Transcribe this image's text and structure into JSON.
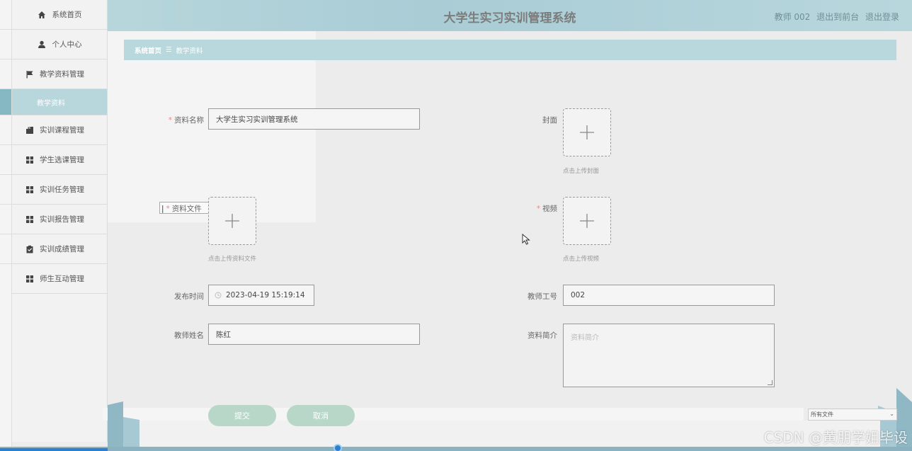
{
  "header": {
    "title": "大学生实习实训管理系统",
    "user_label": "教师 002",
    "back_link": "退出到前台",
    "logout_link": "退出登录"
  },
  "sidebar": {
    "items": [
      {
        "label": "系统首页",
        "icon": "home-icon"
      },
      {
        "label": "个人中心",
        "icon": "user-icon"
      },
      {
        "label": "教学资料管理",
        "icon": "flag-icon"
      },
      {
        "label": "教学资料",
        "icon": ""
      },
      {
        "label": "实训课程管理",
        "icon": "briefcase-icon"
      },
      {
        "label": "学生选课管理",
        "icon": "grid-icon"
      },
      {
        "label": "实训任务管理",
        "icon": "grid-icon"
      },
      {
        "label": "实训报告管理",
        "icon": "grid-icon"
      },
      {
        "label": "实训成绩管理",
        "icon": "clipboard-icon"
      },
      {
        "label": "师生互动管理",
        "icon": "grid-icon"
      }
    ]
  },
  "breadcrumb": {
    "home": "系统首页",
    "separator": "☰",
    "current": "教学资料"
  },
  "form": {
    "name_label": "资料名称",
    "name_value": "大学生实习实训管理系统",
    "cover_label": "封面",
    "cover_hint": "点击上传封面",
    "file_label": "资料文件",
    "file_hint": "点击上传资料文件",
    "video_label": "视频",
    "video_hint": "点击上传视频",
    "publish_time_label": "发布时间",
    "publish_time_value": "2023-04-19 15:19:14",
    "teacher_id_label": "教师工号",
    "teacher_id_value": "002",
    "teacher_name_label": "教师姓名",
    "teacher_name_value": "陈红",
    "intro_label": "资料简介",
    "intro_placeholder": "资料简介",
    "required_mark": "*",
    "submit_label": "提交",
    "cancel_label": "取消"
  },
  "file_filter": {
    "selected": "所有文件"
  },
  "watermark": "CSDN @黄朋学姐毕设",
  "colors": {
    "accent": "#b8d7dd",
    "header": "#a9ccd5",
    "button": "#b8d7c8",
    "required": "#e88888"
  }
}
